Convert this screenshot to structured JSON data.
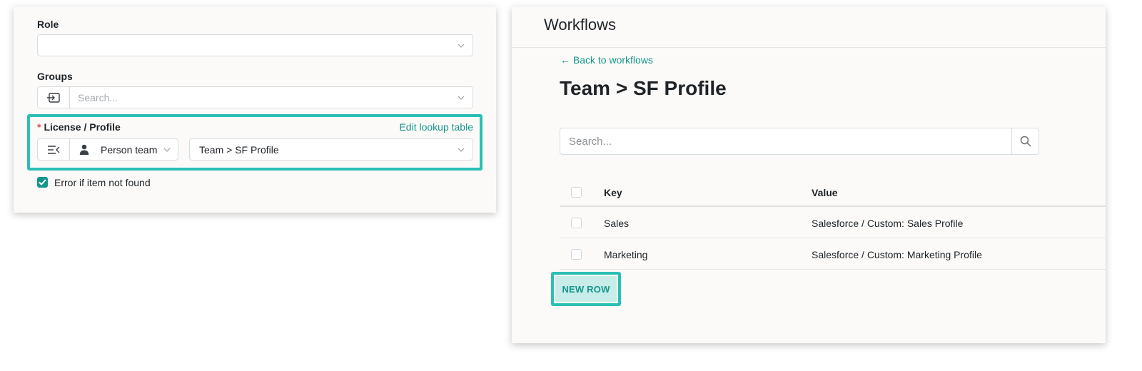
{
  "left_panel": {
    "role": {
      "label": "Role",
      "value": ""
    },
    "groups": {
      "label": "Groups",
      "placeholder": "Search...",
      "addon_icon": "import-icon"
    },
    "license_profile": {
      "required_marker": "*",
      "label": "License / Profile",
      "edit_link": "Edit lookup table",
      "source_icon": "lookup-mapping-icon",
      "source_field_icon": "person-icon",
      "source_field": "Person team",
      "lookup_table": "Team > SF Profile"
    },
    "error_checkbox": {
      "label": "Error if item not found",
      "checked": true
    }
  },
  "right_panel": {
    "app_title": "Workflows",
    "back_link": "← Back to workflows",
    "page_title": "Team > SF Profile",
    "search": {
      "placeholder": "Search...",
      "icon": "search-icon"
    },
    "table": {
      "columns": [
        "Key",
        "Value"
      ],
      "rows": [
        {
          "key": "Sales",
          "value": "Salesforce / Custom: Sales Profile"
        },
        {
          "key": "Marketing",
          "value": "Salesforce / Custom: Marketing Profile"
        }
      ]
    },
    "new_row_button": "NEW ROW"
  },
  "colors": {
    "accent": "#14968b",
    "highlight": "#2bbfb4",
    "button_bg": "#c7ecea",
    "required": "#d9534f"
  }
}
